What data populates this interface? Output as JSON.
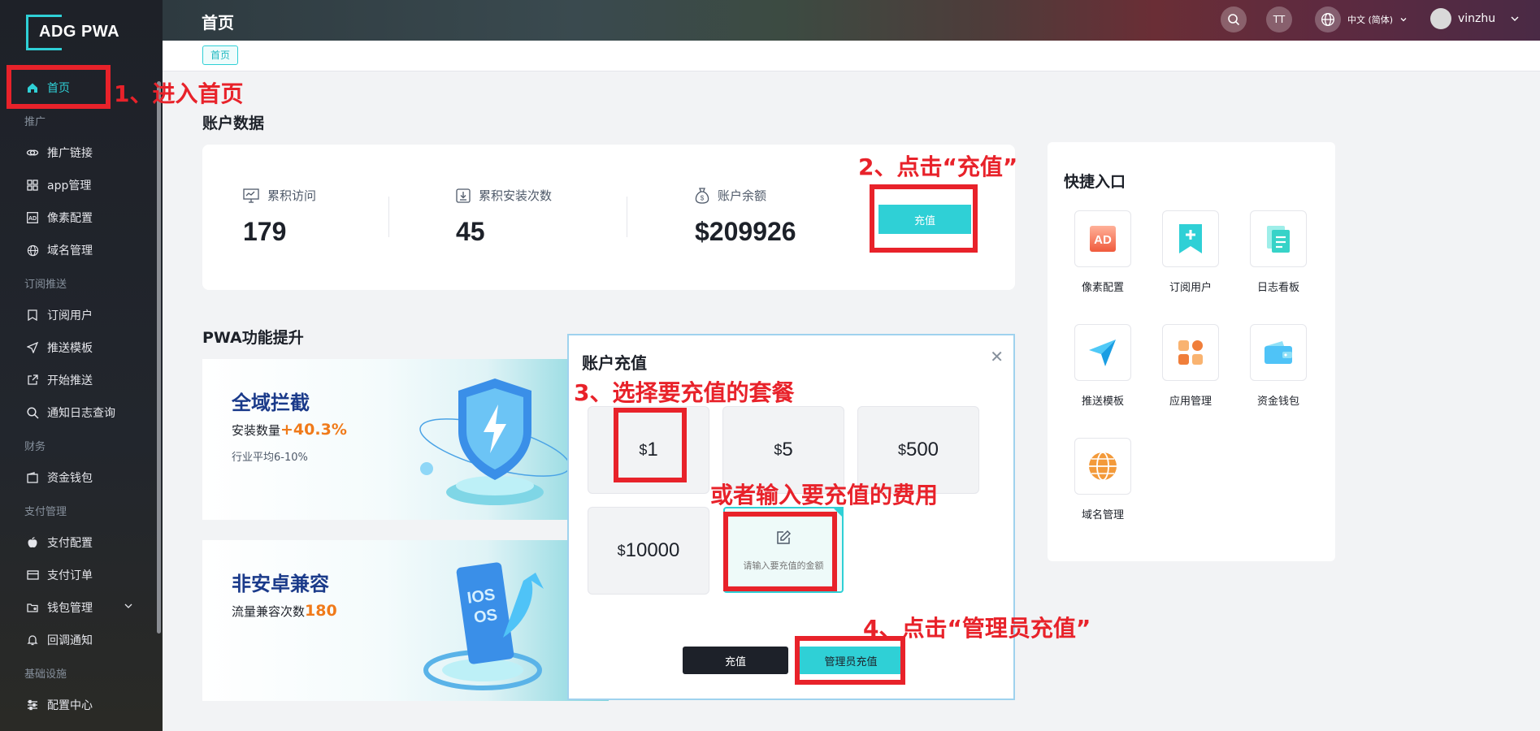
{
  "app": {
    "logo_text": "ADG PWA"
  },
  "header": {
    "title": "首页",
    "lang_label": "中文 (简体)",
    "username": "vinzhu",
    "font_button": "TT"
  },
  "breadcrumb": {
    "current": "首页"
  },
  "sidebar": {
    "home": "首页",
    "groups": {
      "promotion": "推广",
      "subscription": "订阅推送",
      "finance": "财务",
      "payment": "支付管理",
      "infra": "基础设施"
    },
    "items": {
      "promo_link": "推广链接",
      "app_mgmt": "app管理",
      "pixel_config": "像素配置",
      "domain_mgmt": "域名管理",
      "subscribers": "订阅用户",
      "push_template": "推送模板",
      "start_push": "开始推送",
      "notif_log": "通知日志查询",
      "wallet": "资金钱包",
      "pay_config": "支付配置",
      "pay_orders": "支付订单",
      "wallet_mgmt": "钱包管理",
      "callback": "回调通知",
      "config_center": "配置中心"
    }
  },
  "account": {
    "section_title": "账户数据",
    "stats": [
      {
        "label": "累积访问",
        "value": "179"
      },
      {
        "label": "累积安装次数",
        "value": "45"
      },
      {
        "label": "账户余额",
        "value": "$209926"
      }
    ],
    "recharge_label": "充值"
  },
  "features": {
    "section_title": "PWA功能提升",
    "banner1": {
      "title": "全域拦截",
      "sub_prefix": "安装数量",
      "sub_value": "+40.3%",
      "small": "行业平均6-10%"
    },
    "banner2": {
      "title": "非安卓兼容",
      "sub_prefix": "流量兼容次数",
      "sub_value": "180"
    }
  },
  "quick": {
    "title": "快捷入口",
    "items": [
      {
        "label": "像素配置",
        "icon": "ad-icon"
      },
      {
        "label": "订阅用户",
        "icon": "bookmark-plus-icon"
      },
      {
        "label": "日志看板",
        "icon": "document-icon"
      },
      {
        "label": "推送模板",
        "icon": "paper-plane-icon"
      },
      {
        "label": "应用管理",
        "icon": "apps-grid-icon"
      },
      {
        "label": "资金钱包",
        "icon": "wallet-icon"
      },
      {
        "label": "域名管理",
        "icon": "globe-icon"
      }
    ]
  },
  "modal": {
    "title": "账户充值",
    "packages": [
      {
        "currency": "$",
        "amount": "1"
      },
      {
        "currency": "$",
        "amount": "5"
      },
      {
        "currency": "$",
        "amount": "500"
      },
      {
        "currency": "$",
        "amount": "10000"
      }
    ],
    "custom_placeholder": "请输入要充值的金额",
    "recharge_label": "充值",
    "admin_recharge_label": "管理员充值"
  },
  "annotations": {
    "step1": "1、进入首页",
    "step2": "2、点击“充值”",
    "step3": "3、选择要充值的套餐",
    "step3b": "或者输入要充值的费用",
    "step4": "4、点击“管理员充值”"
  },
  "colors": {
    "accent": "#2fd0d6",
    "annotation": "#e8222a",
    "sidebar_bg": "#1e2128"
  }
}
